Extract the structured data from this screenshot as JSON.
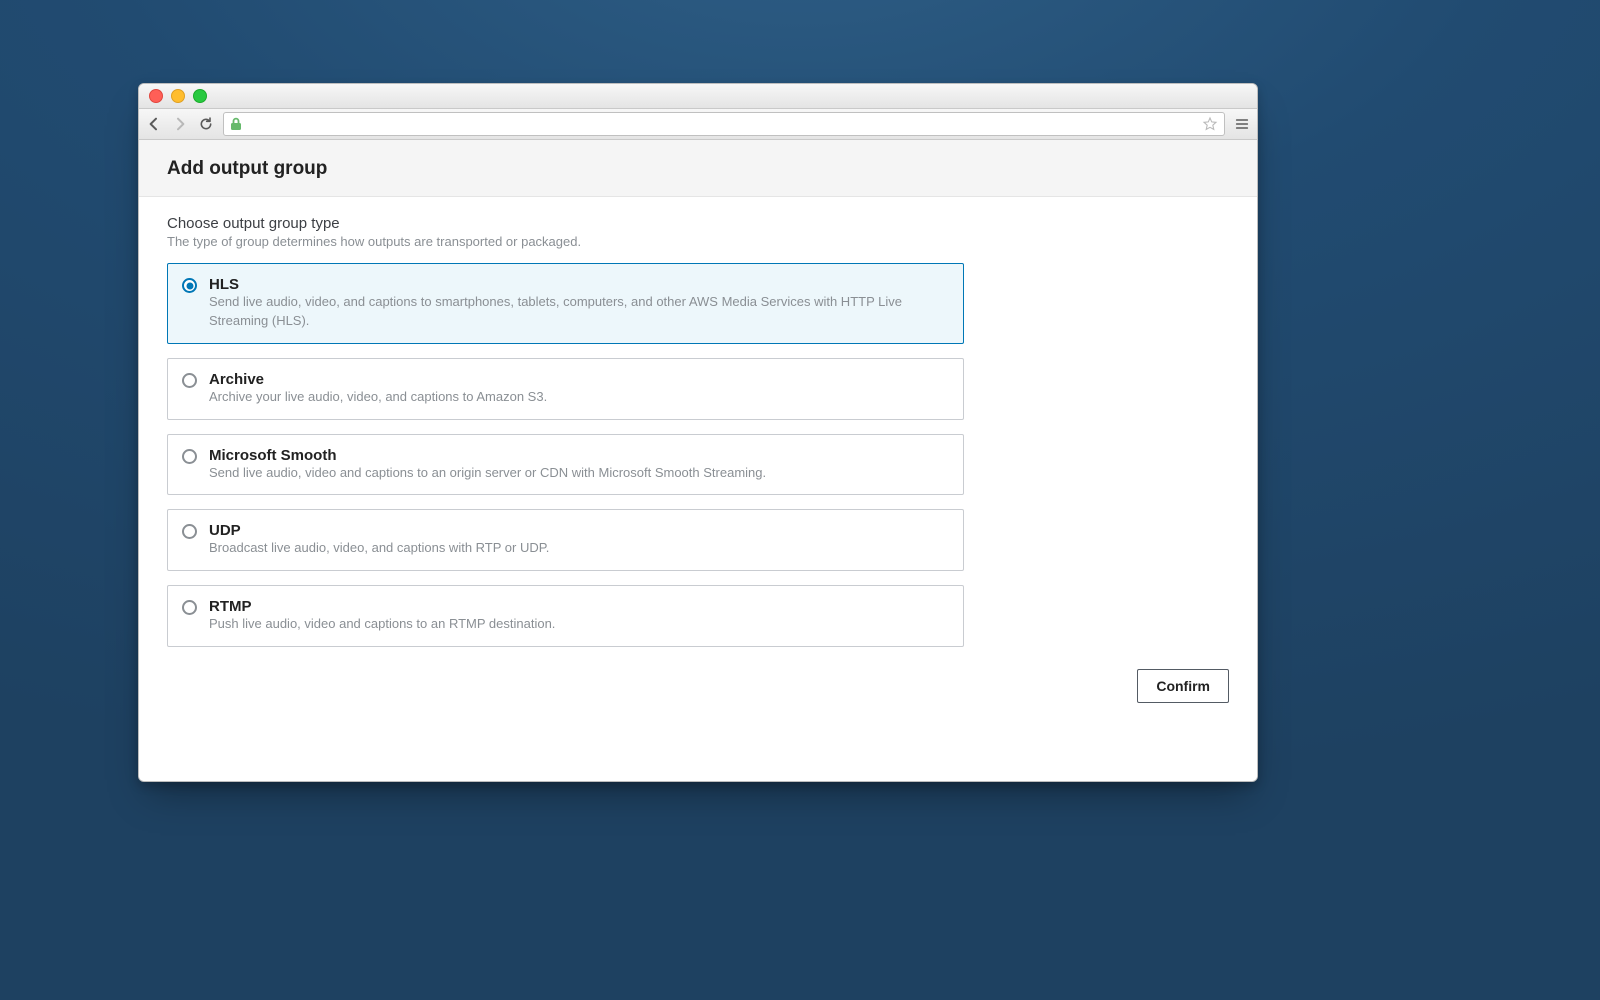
{
  "window": {
    "traffic_lights": {
      "close": true,
      "minimize": true,
      "zoom": true
    }
  },
  "toolbar": {
    "address_value": "",
    "lock_visible": true
  },
  "page": {
    "title": "Add output group",
    "section_title": "Choose output group type",
    "section_subtitle": "The type of group determines how outputs are transported or packaged.",
    "options": [
      {
        "id": "hls",
        "label": "HLS",
        "description": "Send live audio, video, and captions to smartphones, tablets, computers, and other AWS Media Services with HTTP Live Streaming (HLS).",
        "selected": true
      },
      {
        "id": "archive",
        "label": "Archive",
        "description": "Archive your live audio, video, and captions to Amazon S3.",
        "selected": false
      },
      {
        "id": "ms-smooth",
        "label": "Microsoft Smooth",
        "description": "Send live audio, video and captions to an origin server or CDN with Microsoft Smooth Streaming.",
        "selected": false
      },
      {
        "id": "udp",
        "label": "UDP",
        "description": "Broadcast live audio, video, and captions with RTP or UDP.",
        "selected": false
      },
      {
        "id": "rtmp",
        "label": "RTMP",
        "description": "Push live audio, video and captions to an RTMP destination.",
        "selected": false
      }
    ],
    "confirm_label": "Confirm"
  }
}
